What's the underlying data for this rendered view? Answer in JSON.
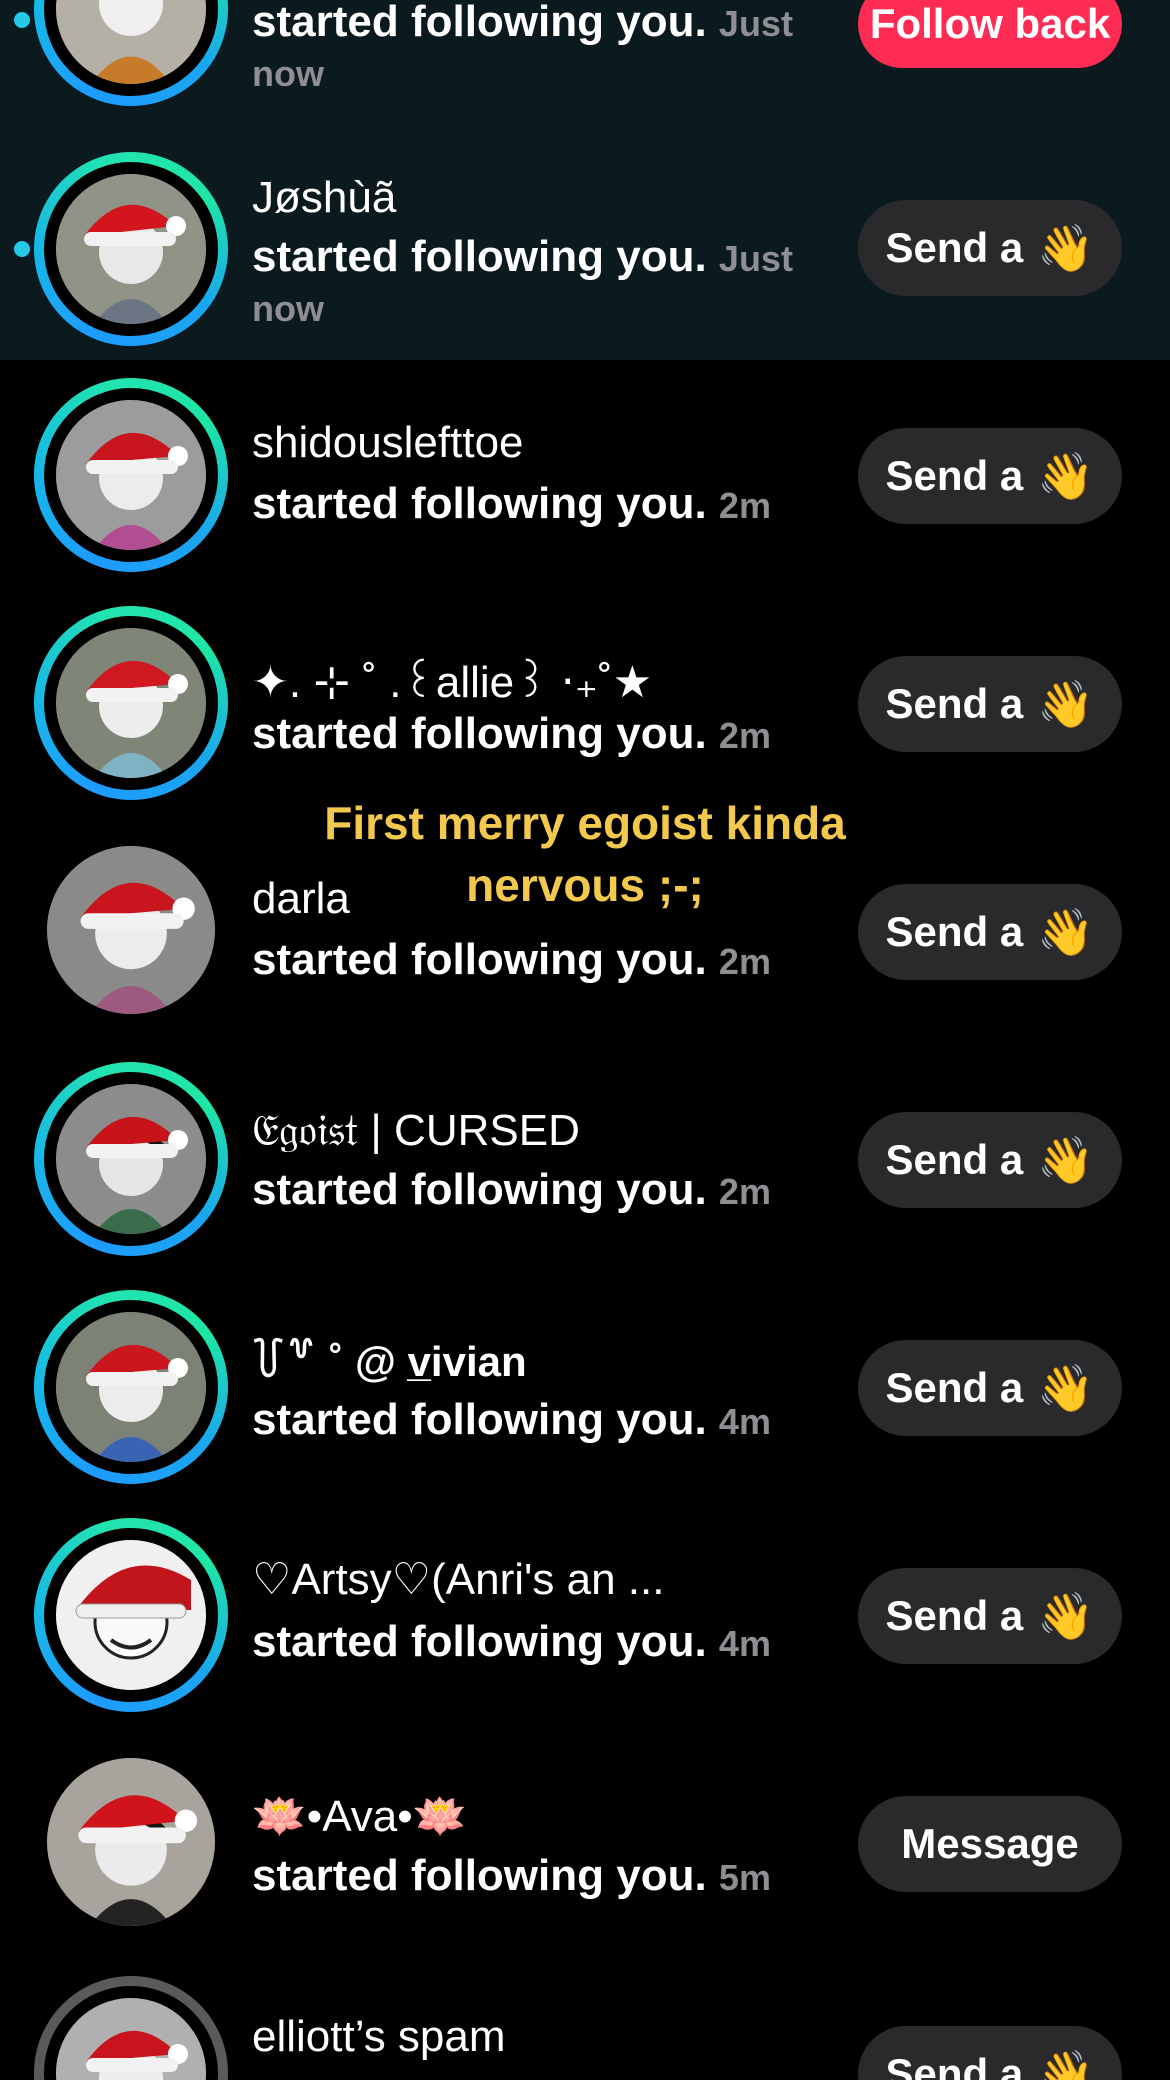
{
  "notifications": [
    {
      "name": "",
      "action": "started following you.",
      "time": "Just now",
      "button": "Follow back",
      "button_type": "primary",
      "unread": true,
      "ring": "gradient"
    },
    {
      "name": "Jøshùã",
      "action": "started following you.",
      "time": "Just now",
      "button": "Send a",
      "button_emoji": "👋",
      "unread": true,
      "ring": "gradient"
    },
    {
      "name": "shidouslefttoe",
      "action": "started following you.",
      "time": "2m",
      "button": "Send a",
      "button_emoji": "👋",
      "unread": false,
      "ring": "gradient"
    },
    {
      "name": "✦. ⊹ ˚ .꒰allie꒱ ‧₊˚★",
      "action": "started following you.",
      "time": "2m",
      "button": "Send a",
      "button_emoji": "👋",
      "unread": false,
      "ring": "gradient"
    },
    {
      "name": "darla",
      "action": "started following you.",
      "time": "2m",
      "button": "Send a",
      "button_emoji": "👋",
      "unread": false,
      "ring": "none"
    },
    {
      "name": "𝔈𝔤𝔬𝔦𝔰𝔱 | CURSED",
      "action": "started following you.",
      "time": "2m",
      "button": "Send a",
      "button_emoji": "👋",
      "unread": false,
      "ring": "gradient"
    },
    {
      "name": "꒦꒷ ˚ @ v̲ivian",
      "action": "started following you.",
      "time": "4m",
      "button": "Send a",
      "button_emoji": "👋",
      "unread": false,
      "ring": "gradient"
    },
    {
      "name": "♡Artsy♡(Anri's an ...",
      "action": "started following you.",
      "time": "4m",
      "button": "Send a",
      "button_emoji": "👋",
      "unread": false,
      "ring": "gradient"
    },
    {
      "name": "🪷•Ava•🪷",
      "action": "started following you.",
      "time": "5m",
      "button": "Message",
      "unread": false,
      "ring": "none"
    },
    {
      "name": "elliott’s spam",
      "action": "",
      "time": "",
      "button": "Send a",
      "button_emoji": "👋",
      "unread": false,
      "ring": "gray"
    }
  ],
  "overlay": {
    "line1": "First merry egoist kinda",
    "line2": "nervous ;-;"
  },
  "colors": {
    "background": "#000000",
    "unread_background": "#0b1a1f",
    "primary_button": "#fe2c55",
    "secondary_button": "#2a2a2c",
    "timestamp": "#8e8e93",
    "overlay_text": "#f2c94c",
    "unread_dot": "#25c9e8"
  }
}
